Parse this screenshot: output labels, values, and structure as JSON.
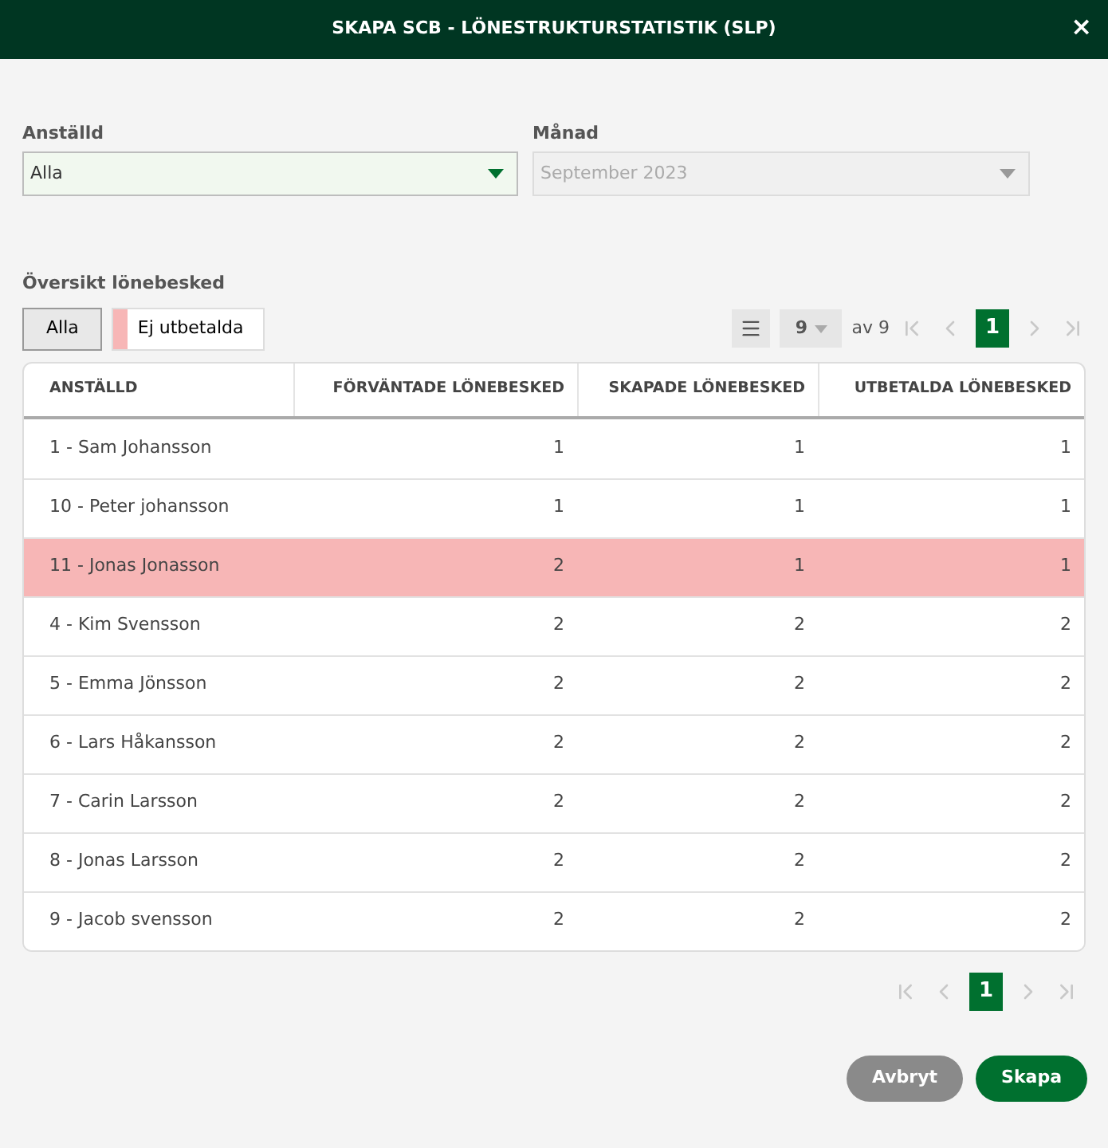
{
  "window": {
    "title": "SKAPA SCB - LÖNESTRUKTURSTATISTIK (SLP)",
    "close": "×"
  },
  "fields": [
    {
      "label": "Anställd",
      "value": "Alla",
      "disabled": false
    },
    {
      "label": "Månad",
      "value": "September 2023",
      "disabled": true
    }
  ],
  "section_title": "Översikt lönebesked",
  "filters": [
    {
      "label": "Alla",
      "selected": true
    },
    {
      "label": "Ej utbetalda",
      "selected": false,
      "color": "#f7b6b6"
    }
  ],
  "pager_top": {
    "page_size": "9",
    "of": "av 9",
    "page": "1"
  },
  "table": {
    "columns": [
      "ANSTÄLLD",
      "FÖRVÄNTADE LÖNEBESKED",
      "SKAPADE LÖNEBESKED",
      "UTBETALDA LÖNEBESKED"
    ],
    "rows": [
      {
        "cells": [
          "1 - Sam Johansson",
          "1",
          "1",
          "1"
        ],
        "highlighted": false
      },
      {
        "cells": [
          "10 - Peter johansson",
          "1",
          "1",
          "1"
        ],
        "highlighted": false
      },
      {
        "cells": [
          "11 - Jonas Jonasson",
          "2",
          "1",
          "1"
        ],
        "highlighted": true
      },
      {
        "cells": [
          "4 - Kim Svensson",
          "2",
          "2",
          "2"
        ],
        "highlighted": false
      },
      {
        "cells": [
          "5 - Emma Jönsson",
          "2",
          "2",
          "2"
        ],
        "highlighted": false
      },
      {
        "cells": [
          "6 - Lars Håkansson",
          "2",
          "2",
          "2"
        ],
        "highlighted": false
      },
      {
        "cells": [
          "7 - Carin Larsson",
          "2",
          "2",
          "2"
        ],
        "highlighted": false
      },
      {
        "cells": [
          "8 - Jonas Larsson",
          "2",
          "2",
          "2"
        ],
        "highlighted": false
      },
      {
        "cells": [
          "9 - Jacob svensson",
          "2",
          "2",
          "2"
        ],
        "highlighted": false
      }
    ]
  },
  "pager_bottom": {
    "page": "1"
  },
  "buttons": [
    {
      "label": "Avbryt",
      "kind": "secondary"
    },
    {
      "label": "Skapa",
      "kind": "primary"
    }
  ]
}
